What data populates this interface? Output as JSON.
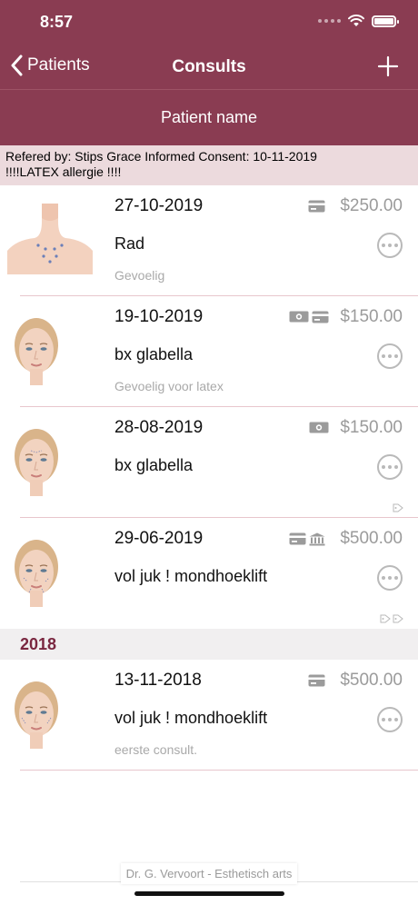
{
  "status_bar": {
    "time": "8:57"
  },
  "nav": {
    "back_label": "Patients",
    "title": "Consults"
  },
  "subheader": {
    "patient_name": "Patient name"
  },
  "info": {
    "line1": "Refered by: Stips Grace  Informed Consent: 10-11-2019",
    "line2": "!!!!LATEX allergie !!!!"
  },
  "consults": [
    {
      "date": "27-10-2019",
      "title": "Rad",
      "note": "Gevoelig",
      "price": "$250.00",
      "payments": [
        "card-icon"
      ],
      "tags": []
    },
    {
      "date": "19-10-2019",
      "title": "bx glabella",
      "note": "Gevoelig voor latex",
      "price": "$150.00",
      "payments": [
        "cash-icon",
        "card-icon"
      ],
      "tags": []
    },
    {
      "date": "28-08-2019",
      "title": "bx glabella",
      "note": "",
      "price": "$150.00",
      "payments": [
        "cash-icon"
      ],
      "tags": [
        "tag-icon"
      ]
    },
    {
      "date": "29-06-2019",
      "title": "vol juk ! mondhoeklift",
      "note": "",
      "price": "$500.00",
      "payments": [
        "card-icon",
        "bank-icon"
      ],
      "tags": [
        "tag-icon",
        "tag-icon"
      ]
    }
  ],
  "sections": [
    {
      "label": "2018",
      "consults": [
        {
          "date": "13-11-2018",
          "title": "vol juk ! mondhoeklift",
          "note": "eerste consult.",
          "price": "$500.00",
          "payments": [
            "card-icon"
          ],
          "tags": []
        }
      ]
    }
  ],
  "footer": {
    "text": "Dr. G. Vervoort - Esthetisch arts"
  },
  "colors": {
    "brand": "#8a3c52",
    "info_background": "#ecdadd",
    "section_label": "#7a2740",
    "muted_text": "#9b9b9b"
  }
}
